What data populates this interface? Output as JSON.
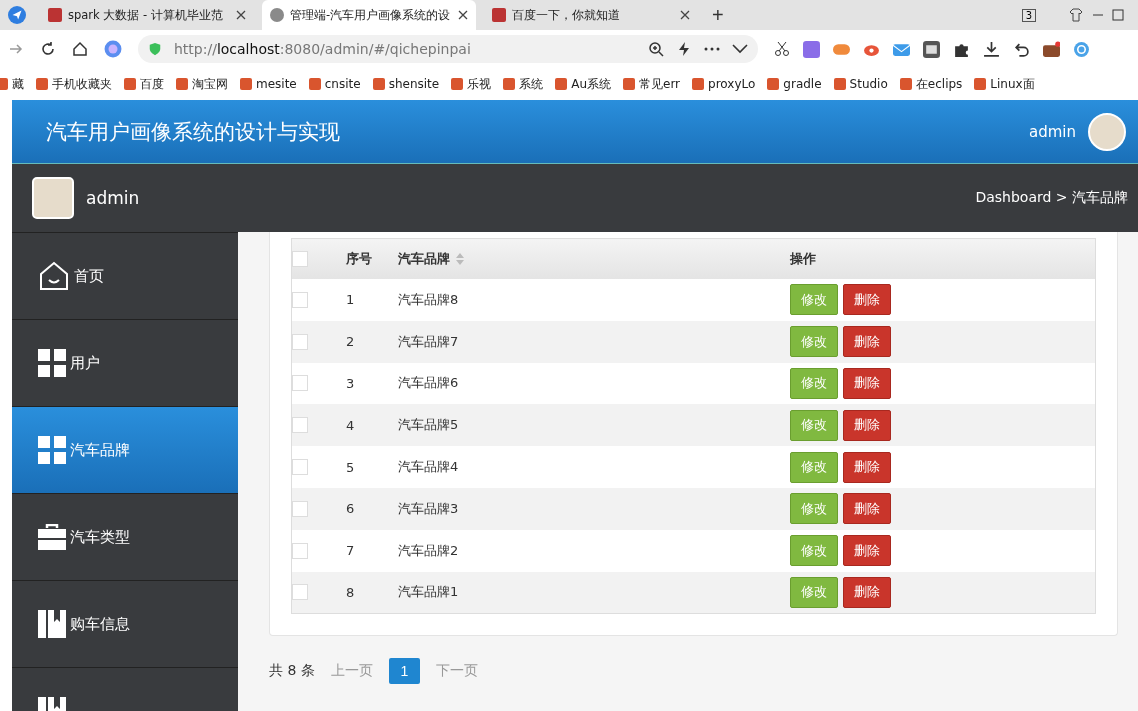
{
  "browser": {
    "tabs": [
      {
        "title": "spark 大数据 - 计算机毕业范",
        "selected": false
      },
      {
        "title": "管理端-汽车用户画像系统的设",
        "selected": true
      },
      {
        "title": "百度一下，你就知道",
        "selected": false
      }
    ],
    "new_tab": "+",
    "tab_count": "3",
    "url_prefix": "http://",
    "url_host": "localhost",
    "url_rest": ":8080/admin/#/qichepinpai",
    "bookmarks": [
      "藏",
      "手机收藏夹",
      "百度",
      "淘宝网",
      "mesite",
      "cnsite",
      "shensite",
      "乐视",
      "系统",
      "Au系统",
      "常见err",
      "proxyLo",
      "gradle",
      "Studio",
      "在eclips",
      "Linux面"
    ]
  },
  "header": {
    "title": "汽车用户画像系统的设计与实现",
    "user": "admin"
  },
  "subbar": {
    "user": "admin",
    "breadcrumb": "Dashboard > 汽车品牌"
  },
  "sidebar": {
    "items": [
      {
        "label": "首页",
        "kind": "home",
        "selected": false
      },
      {
        "label": "用户",
        "kind": "grid",
        "selected": false
      },
      {
        "label": "汽车品牌",
        "kind": "grid",
        "selected": true
      },
      {
        "label": "汽车类型",
        "kind": "case",
        "selected": false
      },
      {
        "label": "购车信息",
        "kind": "book",
        "selected": false
      },
      {
        "kind": "book",
        "selected": false
      }
    ]
  },
  "table": {
    "header_checked": false,
    "columns": [
      "序号",
      "汽车品牌",
      "操作"
    ],
    "rows": [
      {
        "no": "1",
        "brand": "汽车品牌8",
        "checked": false,
        "edit": "修改",
        "delete": "删除"
      },
      {
        "no": "2",
        "brand": "汽车品牌7",
        "checked": false,
        "edit": "修改",
        "delete": "删除"
      },
      {
        "no": "3",
        "brand": "汽车品牌6",
        "checked": false,
        "edit": "修改",
        "delete": "删除"
      },
      {
        "no": "4",
        "brand": "汽车品牌5",
        "checked": false,
        "edit": "修改",
        "delete": "删除"
      },
      {
        "no": "5",
        "brand": "汽车品牌4",
        "checked": false,
        "edit": "修改",
        "delete": "删除"
      },
      {
        "no": "6",
        "brand": "汽车品牌3",
        "checked": false,
        "edit": "修改",
        "delete": "删除"
      },
      {
        "no": "7",
        "brand": "汽车品牌2",
        "checked": false,
        "edit": "修改",
        "delete": "删除"
      },
      {
        "no": "8",
        "brand": "汽车品牌1",
        "checked": false,
        "edit": "修改",
        "delete": "删除"
      }
    ]
  },
  "pagination": {
    "total": "共 8 条",
    "prev": "上一页",
    "pages": [
      {
        "label": "1",
        "selected": true
      }
    ],
    "next": "下一页"
  }
}
